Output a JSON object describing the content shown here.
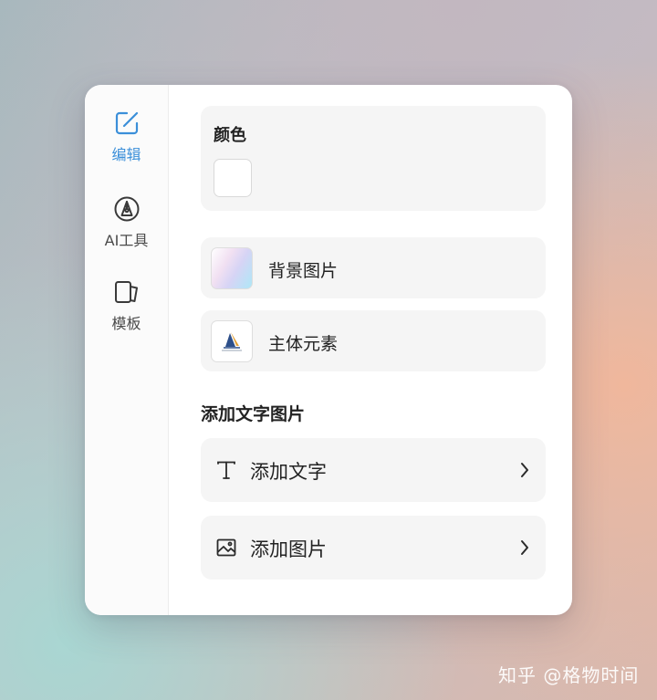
{
  "sidebar": {
    "items": [
      {
        "label": "编辑",
        "icon": "edit-icon",
        "active": true
      },
      {
        "label": "AI工具",
        "icon": "pen-nib-icon",
        "active": false
      },
      {
        "label": "模板",
        "icon": "template-icon",
        "active": false
      }
    ]
  },
  "color_section": {
    "title": "颜色",
    "swatch_color": "#ffffff"
  },
  "assets": [
    {
      "label": "背景图片",
      "icon": "gradient-thumbnail"
    },
    {
      "label": "主体元素",
      "icon": "subject-thumbnail"
    }
  ],
  "add_section": {
    "title": "添加文字图片",
    "actions": [
      {
        "label": "添加文字",
        "icon": "text-icon"
      },
      {
        "label": "添加图片",
        "icon": "image-icon"
      }
    ]
  },
  "accent_color": "#3b8fd9",
  "watermark": "知乎 @格物时间"
}
